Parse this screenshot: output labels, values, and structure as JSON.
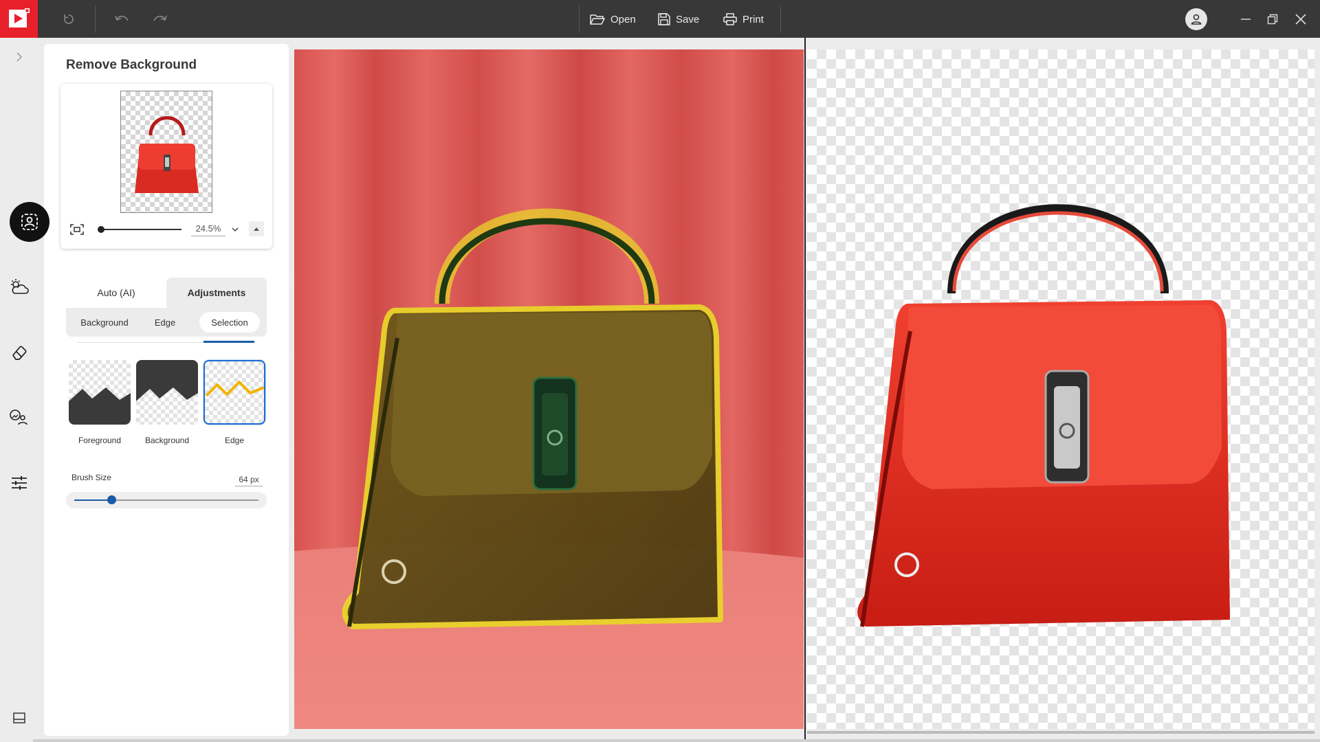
{
  "app": {
    "brand_color": "#e8202a",
    "toolbar": {
      "open_label": "Open",
      "save_label": "Save",
      "print_label": "Print"
    }
  },
  "panel": {
    "title": "Remove Background",
    "zoom": {
      "value": "24.5%",
      "slider_fraction": 0.0
    },
    "tabs": [
      {
        "label": "Auto (AI)",
        "active": false
      },
      {
        "label": "Adjustments",
        "active": true
      }
    ],
    "subtabs": [
      {
        "label": "Background",
        "active": false
      },
      {
        "label": "Edge",
        "active": false
      },
      {
        "label": "Selection",
        "active": true
      }
    ],
    "tools": [
      {
        "label": "Foreground",
        "icon": "mountain-foreground-icon",
        "selected": false
      },
      {
        "label": "Background",
        "icon": "mountain-background-icon",
        "selected": false
      },
      {
        "label": "Edge",
        "icon": "zigzag-edge-icon",
        "selected": true
      }
    ],
    "brush": {
      "label": "Brush Size",
      "value": "64 px",
      "slider_fraction": 0.2
    }
  },
  "rail": {
    "items": [
      "expand-chevron-icon",
      "portrait-icon",
      "weather-icon",
      "eraser-icon",
      "replace-background-icon",
      "sliders-icon",
      "panel-toggle-icon"
    ],
    "active": "portrait-icon"
  },
  "canvas": {
    "left_view": "original photo with edge selection overlay (yellow) on red handbag",
    "right_view": "cut-out handbag on transparent checkerboard"
  }
}
